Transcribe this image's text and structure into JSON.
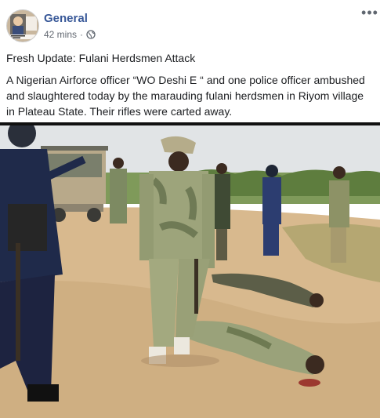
{
  "post": {
    "author": "General",
    "time": "42 mins",
    "separator": "·",
    "privacy_icon": "globe-icon",
    "more_icon": "more-options-icon",
    "more_label": "•••",
    "title": "Fresh Update: Fulani Herdsmen Attack",
    "body": "A Nigerian Airforce officer “WO Deshi E “ and one police officer ambushed and slaughtered today by the marauding fulani herdsmen in Riyom village in Plateau State. Their rifles were carted away."
  },
  "colors": {
    "author_link": "#385898",
    "meta": "#616770",
    "ground": "#d9b98c",
    "sky": "#dfe3e6",
    "camo": "#8c9a6e"
  }
}
